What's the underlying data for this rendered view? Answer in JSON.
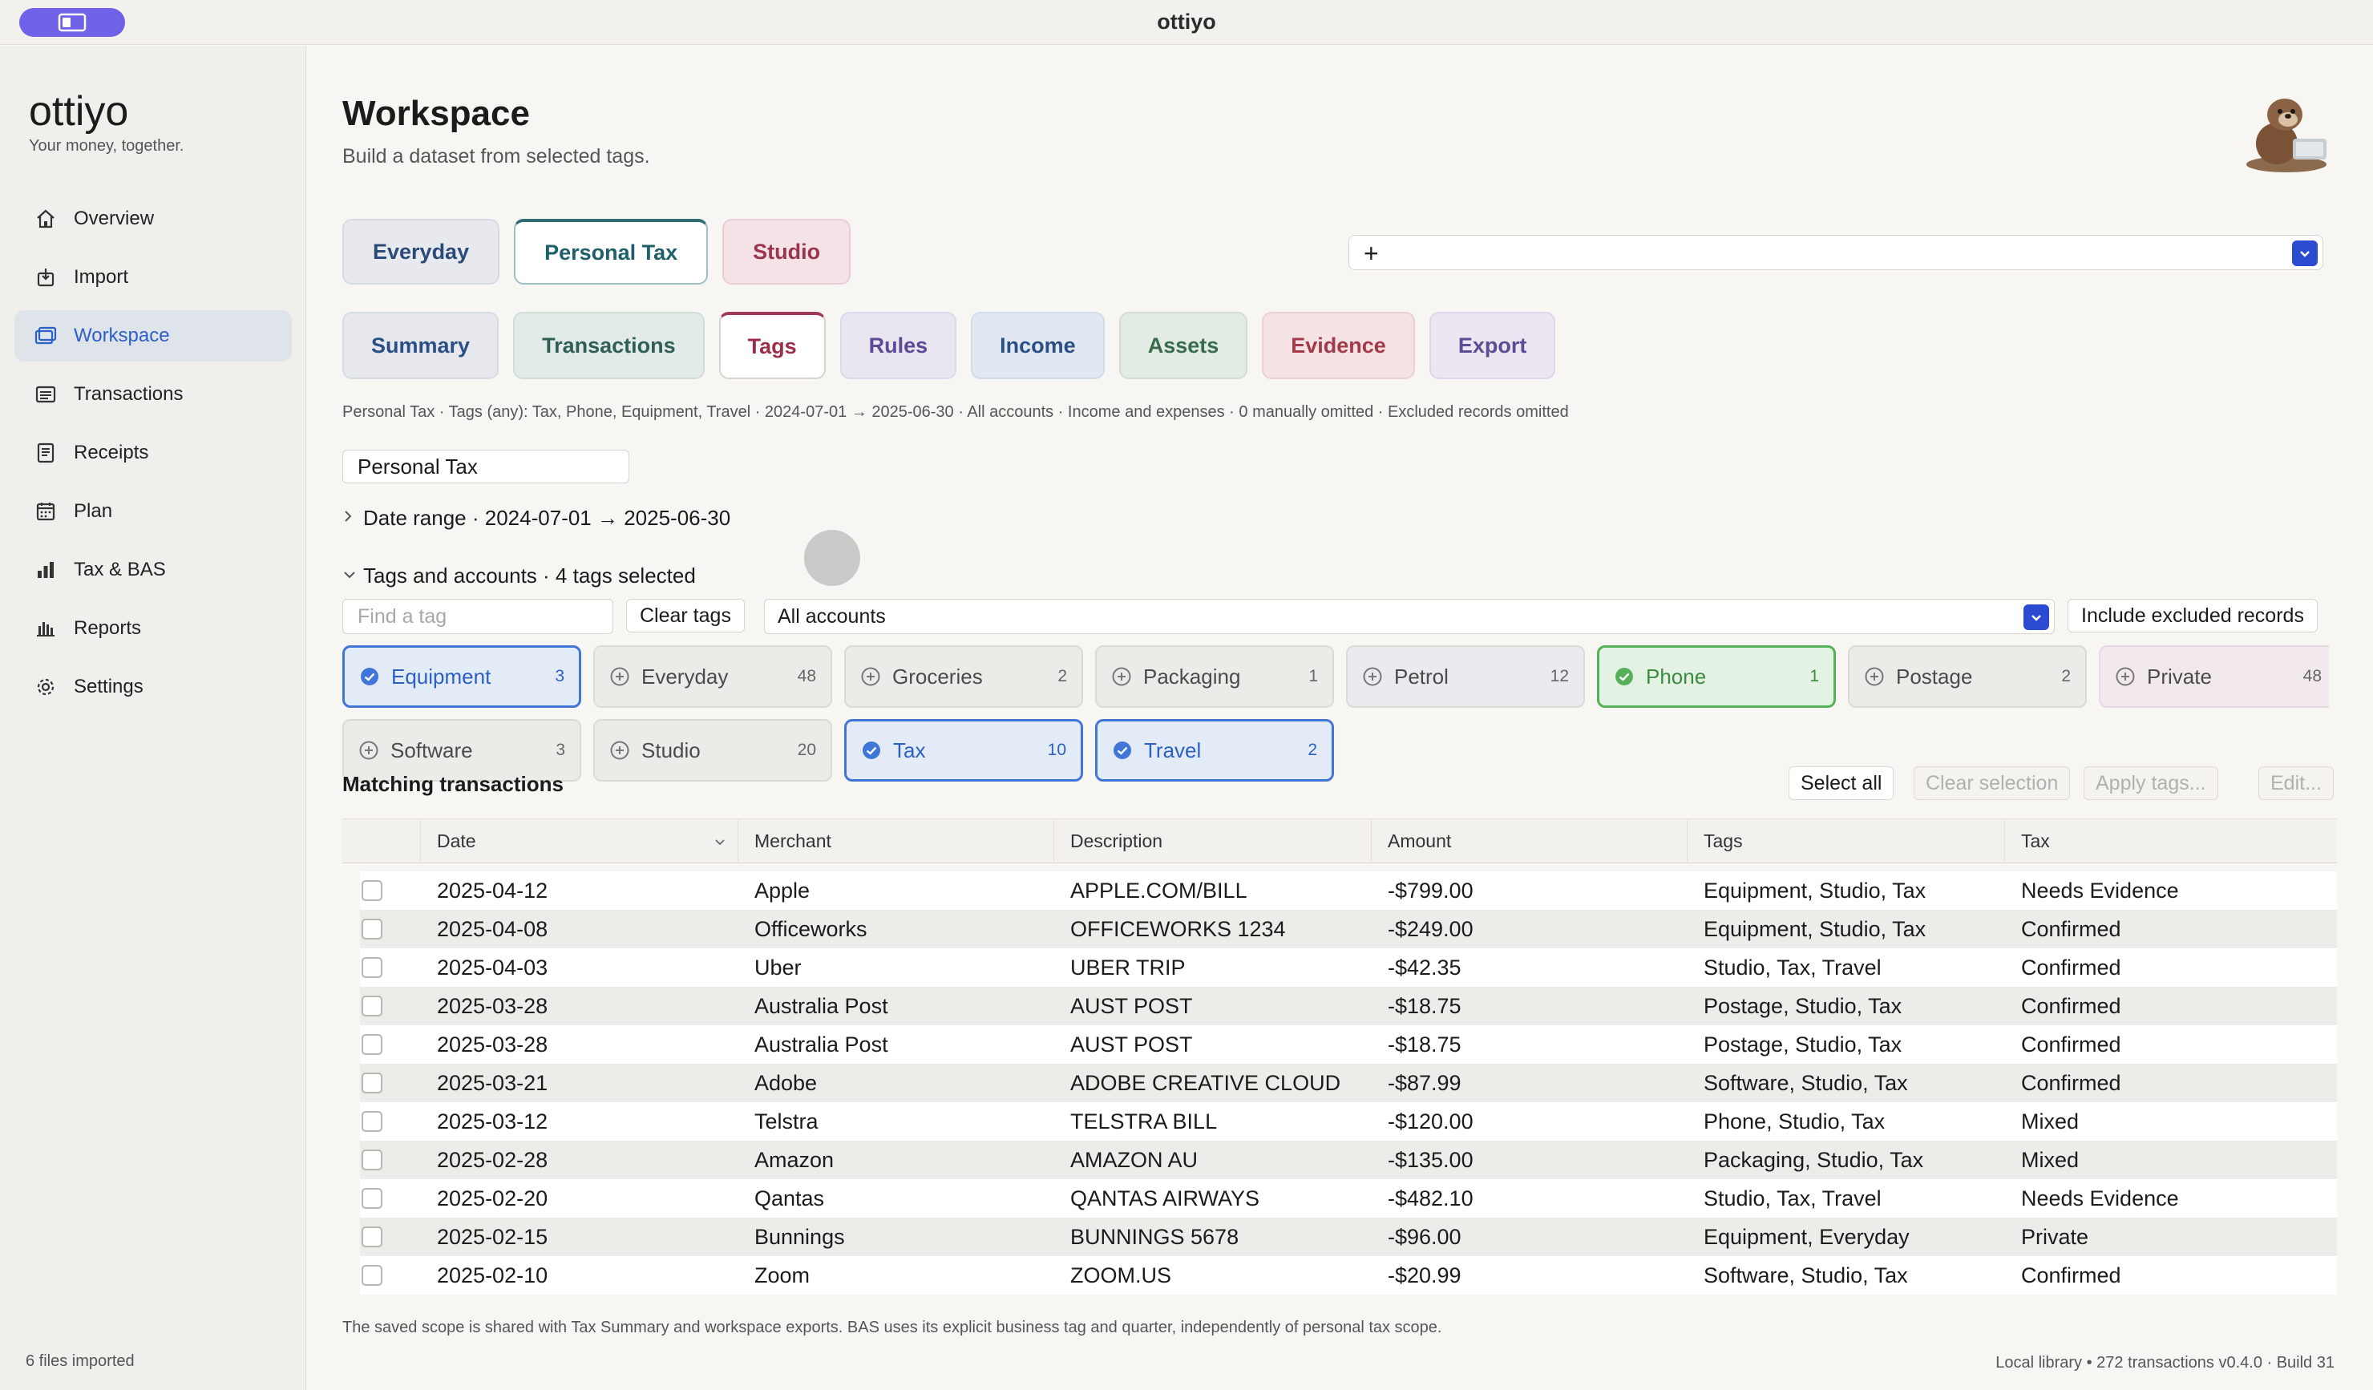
{
  "window": {
    "title": "ottiyo"
  },
  "sidebar": {
    "brand": "ottiyo",
    "tagline": "Your money, together.",
    "items": [
      {
        "label": "Overview",
        "icon": "home-icon"
      },
      {
        "label": "Import",
        "icon": "import-icon"
      },
      {
        "label": "Workspace",
        "icon": "workspace-icon",
        "active": true
      },
      {
        "label": "Transactions",
        "icon": "list-icon"
      },
      {
        "label": "Receipts",
        "icon": "receipt-icon"
      },
      {
        "label": "Plan",
        "icon": "calendar-icon"
      },
      {
        "label": "Tax & BAS",
        "icon": "bar-chart-icon"
      },
      {
        "label": "Reports",
        "icon": "reports-icon"
      },
      {
        "label": "Settings",
        "icon": "gear-icon"
      }
    ],
    "footer": "6 files imported"
  },
  "header": {
    "title": "Workspace",
    "subtitle": "Build a dataset from selected tags."
  },
  "workspace_tabs": [
    {
      "label": "Everyday"
    },
    {
      "label": "Personal Tax",
      "active": true
    },
    {
      "label": "Studio"
    }
  ],
  "scope_select": {
    "plus": "+"
  },
  "sub_tabs": [
    {
      "label": "Summary"
    },
    {
      "label": "Transactions"
    },
    {
      "label": "Tags",
      "active": true
    },
    {
      "label": "Rules"
    },
    {
      "label": "Income"
    },
    {
      "label": "Assets"
    },
    {
      "label": "Evidence"
    },
    {
      "label": "Export"
    }
  ],
  "scope_line": "Personal Tax · Tags (any): Tax, Phone, Equipment, Travel · 2024-07-01 → 2025-06-30 · All accounts · Income and expenses · 0 manually omitted · Excluded records omitted",
  "scope_name": "Personal Tax",
  "date_range_label": "Date range · 2024-07-01 → 2025-06-30",
  "tags_accounts_label": "Tags and accounts · 4 tags selected",
  "find_tag_placeholder": "Find a tag",
  "clear_tags_label": "Clear tags",
  "accounts_value": "All accounts",
  "include_excluded_label": "Include excluded records",
  "tags": [
    {
      "name": "Equipment",
      "count": "3",
      "state": "selected",
      "color": "#3f76d8"
    },
    {
      "name": "Everyday",
      "count": "48"
    },
    {
      "name": "Groceries",
      "count": "2"
    },
    {
      "name": "Packaging",
      "count": "1"
    },
    {
      "name": "Petrol",
      "count": "12"
    },
    {
      "name": "Phone",
      "count": "1",
      "state": "selected",
      "color": "#56b05a"
    },
    {
      "name": "Postage",
      "count": "2"
    },
    {
      "name": "Private",
      "count": "48"
    },
    {
      "name": "Software",
      "count": "3"
    },
    {
      "name": "Studio",
      "count": "20"
    },
    {
      "name": "Tax",
      "count": "10",
      "state": "selected",
      "color": "#3f76d8"
    },
    {
      "name": "Travel",
      "count": "2",
      "state": "selected",
      "color": "#3f76d8"
    }
  ],
  "matching": {
    "title": "Matching transactions",
    "select_all": "Select all",
    "clear_selection": "Clear selection",
    "apply_tags": "Apply tags...",
    "edit": "Edit..."
  },
  "table": {
    "columns": [
      "Date",
      "Merchant",
      "Description",
      "Amount",
      "Tags",
      "Tax"
    ],
    "rows": [
      {
        "date": "2025-04-12",
        "merchant": "Apple",
        "description": "APPLE.COM/BILL",
        "amount": "-$799.00",
        "tags": "Equipment, Studio, Tax",
        "tax": "Needs Evidence"
      },
      {
        "date": "2025-04-08",
        "merchant": "Officeworks",
        "description": "OFFICEWORKS 1234",
        "amount": "-$249.00",
        "tags": "Equipment, Studio, Tax",
        "tax": "Confirmed"
      },
      {
        "date": "2025-04-03",
        "merchant": "Uber",
        "description": "UBER TRIP",
        "amount": "-$42.35",
        "tags": "Studio, Tax, Travel",
        "tax": "Confirmed"
      },
      {
        "date": "2025-03-28",
        "merchant": "Australia Post",
        "description": "AUST POST",
        "amount": "-$18.75",
        "tags": "Postage, Studio, Tax",
        "tax": "Confirmed"
      },
      {
        "date": "2025-03-28",
        "merchant": "Australia Post",
        "description": "AUST POST",
        "amount": "-$18.75",
        "tags": "Postage, Studio, Tax",
        "tax": "Confirmed"
      },
      {
        "date": "2025-03-21",
        "merchant": "Adobe",
        "description": "ADOBE CREATIVE CLOUD",
        "amount": "-$87.99",
        "tags": "Software, Studio, Tax",
        "tax": "Confirmed"
      },
      {
        "date": "2025-03-12",
        "merchant": "Telstra",
        "description": "TELSTRA BILL",
        "amount": "-$120.00",
        "tags": "Phone, Studio, Tax",
        "tax": "Mixed"
      },
      {
        "date": "2025-02-28",
        "merchant": "Amazon",
        "description": "AMAZON AU",
        "amount": "-$135.00",
        "tags": "Packaging, Studio, Tax",
        "tax": "Mixed"
      },
      {
        "date": "2025-02-20",
        "merchant": "Qantas",
        "description": "QANTAS AIRWAYS",
        "amount": "-$482.10",
        "tags": "Studio, Tax, Travel",
        "tax": "Needs Evidence"
      },
      {
        "date": "2025-02-15",
        "merchant": "Bunnings",
        "description": "BUNNINGS 5678",
        "amount": "-$96.00",
        "tags": "Equipment, Everyday",
        "tax": "Private"
      },
      {
        "date": "2025-02-10",
        "merchant": "Zoom",
        "description": "ZOOM.US",
        "amount": "-$20.99",
        "tags": "Software, Studio, Tax",
        "tax": "Confirmed"
      }
    ]
  },
  "footnote": "The saved scope is shared with Tax Summary and workspace exports. BAS uses its explicit business tag and quarter, independently of personal tax scope.",
  "status": "Local library • 272 transactions   v0.4.0 · Build 31",
  "colors": {
    "accent": "#2c4bd1",
    "sidebar_active": "#2d5fc9",
    "toggle": "#6f61e8"
  }
}
